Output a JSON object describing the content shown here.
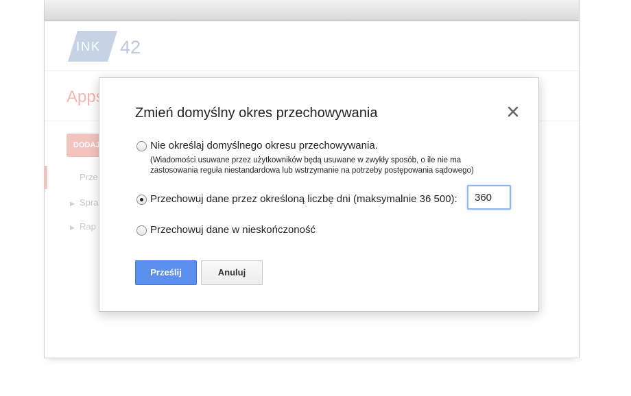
{
  "logo": {
    "ink": "INK",
    "number": "42"
  },
  "background": {
    "apps_title": "Apps",
    "add_button": "DODAJ",
    "nav_items": [
      "Prze",
      "Spra",
      "Rap"
    ]
  },
  "dialog": {
    "title": "Zmień domyślny okres przechowywania",
    "close_icon": "close-icon",
    "options": [
      {
        "label": "Nie określaj domyślnego okresu przechowywania.",
        "note_line1": "(Wiadomości usuwane przez użytkowników będą usuwane w zwykły sposób, o ile nie ma",
        "note_line2": "zastosowania reguła niestandardowa lub wstrzymanie na potrzeby postępowania sądowego)",
        "checked": false
      },
      {
        "label": "Przechowuj dane przez określoną liczbę dni (maksymalnie 36 500):",
        "checked": true
      },
      {
        "label": "Przechowuj dane w nieskończoność",
        "checked": false
      }
    ],
    "days_value": "360",
    "submit_label": "Prześlij",
    "cancel_label": "Anuluj"
  },
  "colors": {
    "primary_button": "#5b8fee",
    "accent_faded": "#f4c3bd",
    "logo_block": "#c5d3e4",
    "input_focus": "#8fb4ee"
  }
}
